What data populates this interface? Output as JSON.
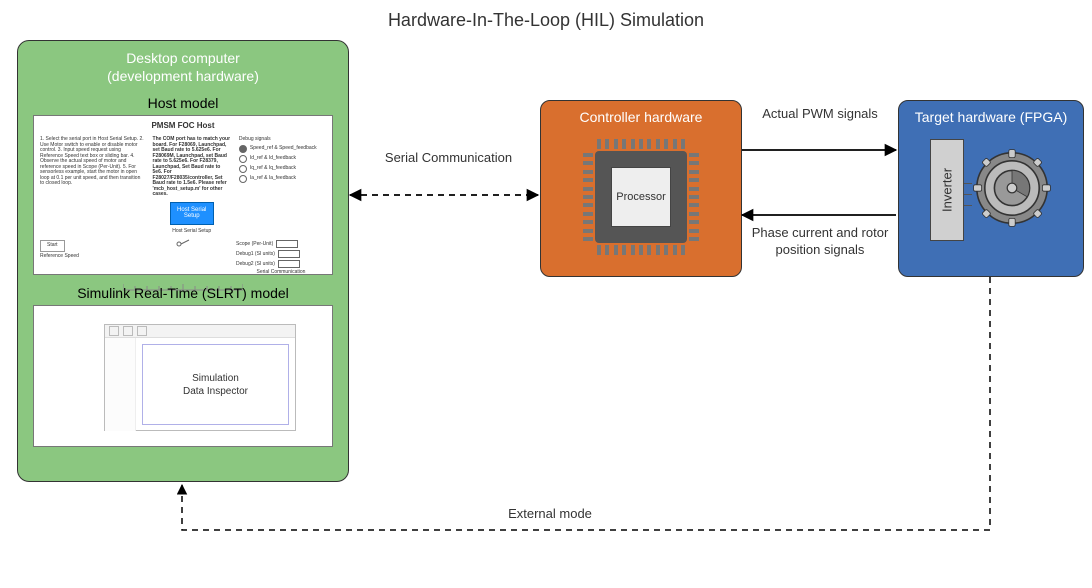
{
  "title": "Hardware-In-The-Loop (HIL) Simulation",
  "desktop": {
    "title_line1": "Desktop computer",
    "title_line2": "(development hardware)",
    "host_label": "Host model",
    "host_panel": {
      "title": "PMSM FOC Host",
      "instructions": "1. Select the serial port in Host Serial Setup.\n2. Use Motor switch to enable or disable motor control.\n3. Input speed request using Reference Speed text box or sliding bar.\n4. Observe the actual speed of motor and reference speed in Scope (Per-Unit).\n5. For sensorless example, start the motor in open loop at 0.1 per unit speed, and then transition to closed loop.",
      "note": "The COM port has to match your board.\nFor F28069, Launchpad, set Baud rate to 5.625e6.\nFor F28069M, Launchpad, set Baud rate to 5.625e6.\nFor F28379, Launchpad, Set Baud rate to 5e6.\nFor F28027/F28035/controller, Set Baud rate to 1.5e6.\nPlease refer 'mcb_host_setup.m' for other cases.",
      "button": "Host Serial Setup",
      "start_label": "Start",
      "ref_speed_label": "Reference Speed",
      "debug_label": "Debug signals",
      "radios": [
        "Speed_ref & Speed_feedback",
        "Id_ref & Id_feedback",
        "Iq_ref & Iq_feedback",
        "Ia_ref & Ia_feedback"
      ],
      "scope_label": "Scope (Per-Unit)",
      "debug1": "Debug1 (SI units)",
      "debug2": "Debug2 (SI units)",
      "serial_comm": "Serial Communication"
    },
    "slrt_label": "Simulink Real-Time (SLRT) model",
    "slrt_panel": {
      "window_label_line1": "Simulation",
      "window_label_line2": "Data Inspector"
    }
  },
  "controller": {
    "title": "Controller hardware",
    "chip_label": "Processor"
  },
  "target": {
    "title": "Target hardware (FPGA)",
    "inverter_label": "Inverter"
  },
  "connections": {
    "serial": "Serial Communication",
    "pwm": "Actual PWM signals",
    "phase": "Phase current and rotor position signals",
    "external_mode": "External mode"
  }
}
